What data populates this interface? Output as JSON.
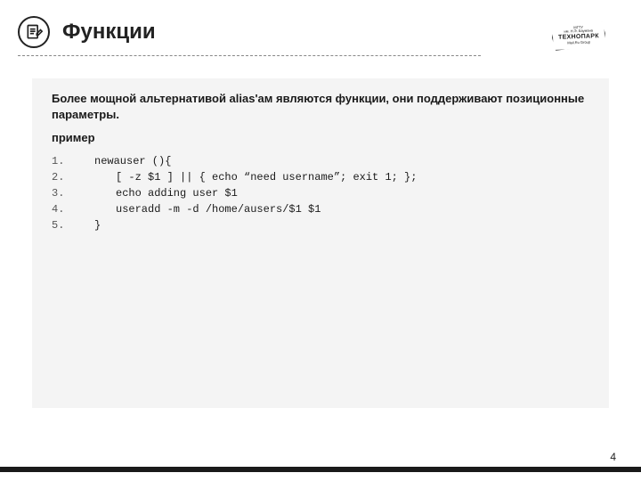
{
  "header": {
    "title": "Функции"
  },
  "logo": {
    "line_top_1": "МГТУ",
    "line_top_2": "им. Н.Э. Баумана",
    "brand": "ТЕХНОПАРК",
    "bottom": "Mail.Ru Group"
  },
  "body": {
    "intro": "Более мощной альтернативой alias'ам являются функции, они поддерживают позиционные параметры.",
    "subhead": "пример",
    "code": [
      {
        "n": "1.",
        "indent": 1,
        "text": "newauser (){"
      },
      {
        "n": "2.",
        "indent": 2,
        "text": "[ -z $1 ] || { echo “need username”; exit 1; };"
      },
      {
        "n": "3.",
        "indent": 2,
        "text": "echo adding user $1"
      },
      {
        "n": "4.",
        "indent": 2,
        "text": "useradd -m -d /home/ausers/$1 $1"
      },
      {
        "n": "5.",
        "indent": 1,
        "text": "}"
      }
    ]
  },
  "page": {
    "number": "4"
  }
}
